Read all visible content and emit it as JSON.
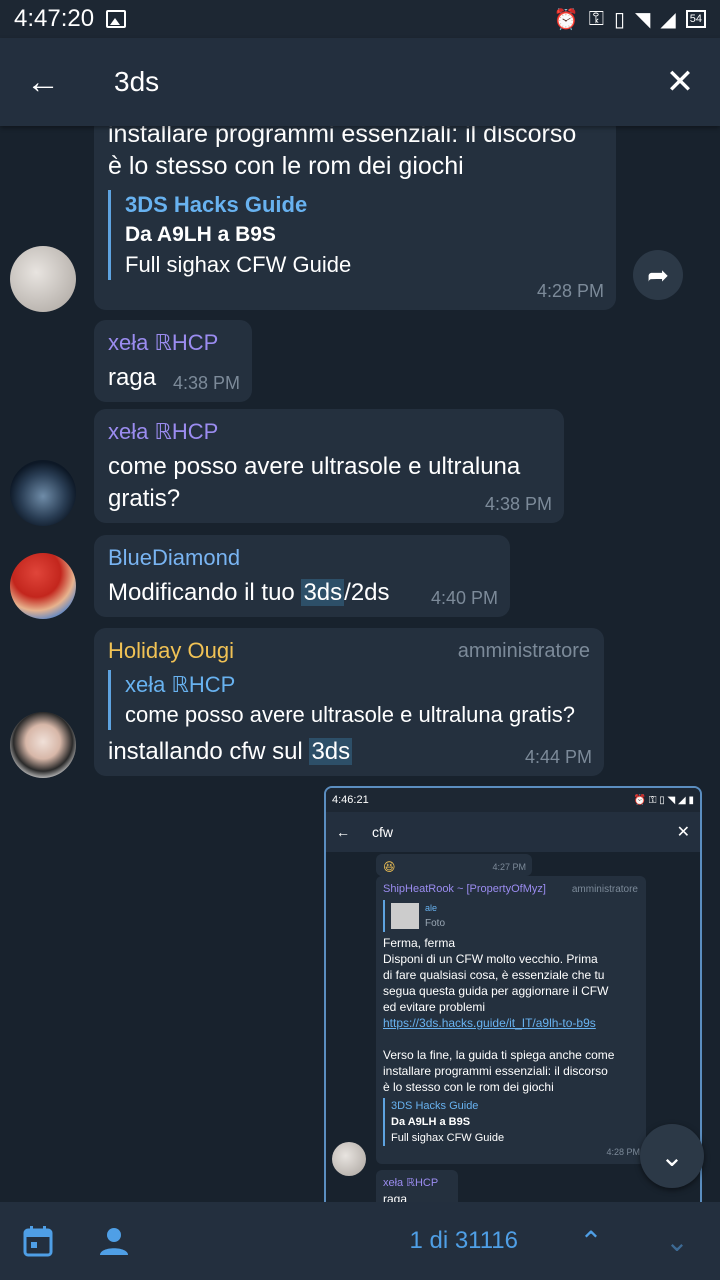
{
  "status": {
    "time": "4:47:20",
    "icons": [
      "image-icon",
      "alarm-icon",
      "key-icon",
      "vibrate-icon",
      "wifi-icon",
      "signal-icon",
      "battery-icon"
    ],
    "battery": "54"
  },
  "search": {
    "query": "3ds"
  },
  "messages": [
    {
      "id": "m1",
      "text_lines": [
        "installare programmi essenziali: il discorso",
        "è lo stesso con le rom dei giochi"
      ],
      "link_preview": {
        "site": "3DS Hacks Guide",
        "title": "Da A9LH a B9S",
        "desc": "Full sighax CFW Guide"
      },
      "time": "4:28 PM"
    },
    {
      "id": "m2",
      "sender": "xeła ℝHCP",
      "text": "raga",
      "time": "4:38 PM"
    },
    {
      "id": "m3",
      "sender": "xeła ℝHCP",
      "text": "come posso avere ultrasole e ultraluna gratis?",
      "time": "4:38 PM"
    },
    {
      "id": "m4",
      "sender": "BlueDiamond",
      "text_before": "Modificando il tuo ",
      "highlight": "3ds",
      "text_after": "/2ds",
      "time": "4:40 PM"
    },
    {
      "id": "m5",
      "sender": "Holiday Ougi",
      "role": "amministratore",
      "reply": {
        "sender": "xeła ℝHCP",
        "text": "come posso avere ultrasole e ultraluna gratis?"
      },
      "text_before": "installando cfw sul ",
      "highlight": "3ds",
      "time": "4:44 PM"
    }
  ],
  "screenshot": {
    "time": "4:46:21",
    "query": "cfw",
    "prev_time": "4:27 PM",
    "sender": "ShipHeatRook ~ [PropertyOfMyz]",
    "role": "amministratore",
    "reply_sender": "ale",
    "reply_text": "Foto",
    "lines": [
      "Ferma, ferma",
      "Disponi di un CFW molto vecchio. Prima",
      "di fare qualsiasi cosa, è essenziale che tu",
      "segua questa guida per aggiornare il CFW",
      "ed evitare problemi"
    ],
    "link": "https://3ds.hacks.guide/it_IT/a9lh-to-b9s",
    "lines2": [
      "Verso la fine, la guida ti spiega anche come",
      "installare programmi essenziali: il discorso",
      "è lo stesso con le rom dei giochi"
    ],
    "preview_site": "3DS Hacks Guide",
    "preview_title": "Da A9LH a B9S",
    "preview_desc": "Full sighax CFW Guide",
    "preview_time": "4:28 PM",
    "next_sender": "xeła ℝHCP",
    "next_text": "raga"
  },
  "bottom": {
    "counter": "1 di 31116"
  },
  "colors": {
    "name_purple": "#9b8cf0",
    "name_blue": "#79b4f2",
    "name_gold": "#f1c255",
    "admin": "#7c8a99",
    "accent": "#4f9fe6"
  }
}
